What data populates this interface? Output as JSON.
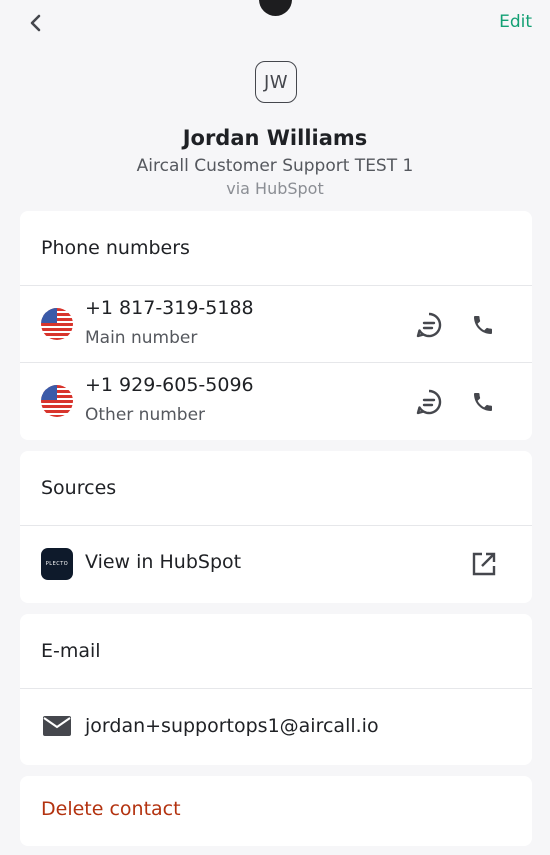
{
  "header": {
    "edit_label": "Edit"
  },
  "contact": {
    "initials": "JW",
    "name": "Jordan Williams",
    "company": "Aircall Customer Support TEST 1",
    "source_line": "via HubSpot"
  },
  "phone_section": {
    "title": "Phone numbers",
    "items": [
      {
        "number": "+1 817-319-5188",
        "label": "Main number",
        "country": "US"
      },
      {
        "number": "+1 929-605-5096",
        "label": "Other number",
        "country": "US"
      }
    ]
  },
  "sources_section": {
    "title": "Sources",
    "item_label": "View in HubSpot",
    "logo_text": "PLECTO"
  },
  "email_section": {
    "title": "E-mail",
    "address": "jordan+supportops1@aircall.io"
  },
  "delete_label": "Delete contact",
  "colors": {
    "accent": "#13a074",
    "danger": "#b3320f",
    "background": "#f6f6f8"
  },
  "icons": [
    "chevron-left-icon",
    "message-icon",
    "phone-icon",
    "external-link-icon",
    "mail-icon",
    "us-flag-icon"
  ]
}
